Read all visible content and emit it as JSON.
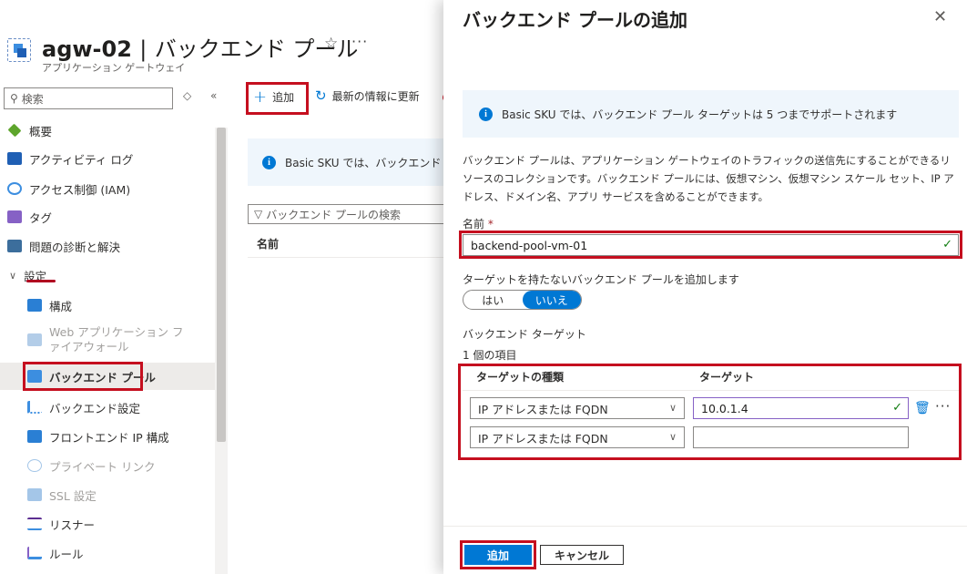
{
  "resource": {
    "name": "agw-02",
    "separator": "|",
    "section": "バックエンド プール",
    "subtitle": "アプリケーション ゲートウェイ"
  },
  "sidebar": {
    "search_placeholder": "検索",
    "items": [
      {
        "label": "概要"
      },
      {
        "label": "アクティビティ ログ"
      },
      {
        "label": "アクセス制御 (IAM)"
      },
      {
        "label": "タグ"
      },
      {
        "label": "問題の診断と解決"
      },
      {
        "label": "設定"
      },
      {
        "label": "構成"
      },
      {
        "label": "Web アプリケーション ファイアウォール"
      },
      {
        "label": "バックエンド プール"
      },
      {
        "label": "バックエンド設定"
      },
      {
        "label": "フロントエンド IP 構成"
      },
      {
        "label": "プライベート リンク"
      },
      {
        "label": "SSL 設定"
      },
      {
        "label": "リスナー"
      },
      {
        "label": "ルール"
      }
    ]
  },
  "toolbar": {
    "add_label": "追加",
    "refresh_label": "最新の情報に更新"
  },
  "main": {
    "info_text": "Basic SKU では、バックエンド プール",
    "filter_placeholder": "バックエンド プールの検索",
    "column_name": "名前"
  },
  "panel": {
    "title": "バックエンド プールの追加",
    "info_text": "Basic SKU では、バックエンド プール ターゲットは 5 つまでサポートされます",
    "description": "バックエンド プールは、アプリケーション ゲートウェイのトラフィックの送信先にすることができるリソースのコレクションです。バックエンド プールには、仮想マシン、仮想マシン スケール セット、IP アドレス、ドメイン名、アプリ サービスを含めることができます。",
    "name_label": "名前",
    "required_mark": "*",
    "name_value": "backend-pool-vm-01",
    "no_target_label": "ターゲットを持たないバックエンド プールを追加します",
    "toggle_yes": "はい",
    "toggle_no": "いいえ",
    "targets_label": "バックエンド ターゲット",
    "item_count": "1 個の項目",
    "col_type": "ターゲットの種類",
    "col_target": "ターゲット",
    "rows": [
      {
        "type": "IP アドレスまたは FQDN",
        "target": "10.0.1.4"
      },
      {
        "type": "IP アドレスまたは FQDN",
        "target": ""
      }
    ],
    "add_button": "追加",
    "cancel_button": "キャンセル"
  },
  "colors": {
    "accent": "#0078d4",
    "highlight_border": "#c50f1f",
    "info_background": "#eff6fc",
    "valid": "#107c10"
  }
}
